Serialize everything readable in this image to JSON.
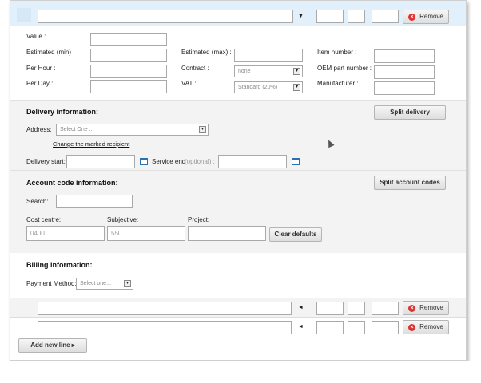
{
  "top_row": {
    "remove_label": "Remove",
    "arrow": "▼"
  },
  "item_details": {
    "value_label": "Value :",
    "estimated_min_label": "Estimated (min) :",
    "estimated_max_label": "Estimated (max) :",
    "item_number_label": "Item number :",
    "per_hour_label": "Per Hour :",
    "contract_label": "Contract :",
    "contract_value": "none",
    "oem_label": "OEM part number :",
    "per_day_label": "Per Day :",
    "vat_label": "VAT :",
    "vat_value": "Standard (20%)",
    "manufacturer_label": "Manufacturer :"
  },
  "delivery": {
    "heading": "Delivery information:",
    "split_label": "Split delivery",
    "address_label": "Address:",
    "address_placeholder": "Select One ...",
    "change_link": "Change the marked recipient",
    "start_label": "Delivery start:",
    "service_end_label": "Service end",
    "optional_label": "(optional) :"
  },
  "account": {
    "heading": "Account code information:",
    "split_label": "Split account codes",
    "search_label": "Search:",
    "cost_centre_label": "Cost centre:",
    "cost_centre_value": "0400",
    "subjective_label": "Subjective:",
    "subjective_value": "550",
    "project_label": "Project:",
    "clear_label": "Clear defaults"
  },
  "billing": {
    "heading": "Billing information:",
    "payment_label": "Payment Method:",
    "payment_placeholder": "Select one..."
  },
  "lines": [
    {
      "arrow": "◄",
      "remove_label": "Remove"
    },
    {
      "arrow": "◄",
      "remove_label": "Remove"
    }
  ],
  "add_line_label": "Add new line ▸",
  "colors": {
    "row_highlight": "#e2f0fb",
    "section_alt": "#f3f3f3",
    "remove_icon": "#dd3333",
    "calendar": "#2a6fb0"
  }
}
